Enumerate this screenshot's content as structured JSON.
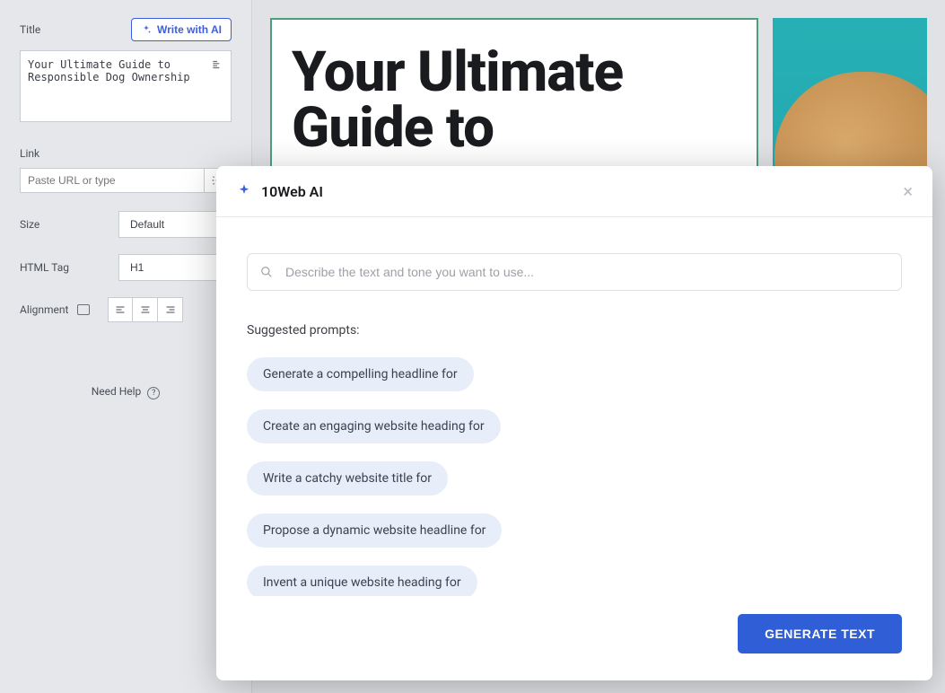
{
  "sidebar": {
    "title_label": "Title",
    "write_ai_label": "Write with AI",
    "title_value": "Your Ultimate Guide to Responsible Dog Ownership",
    "link_label": "Link",
    "link_placeholder": "Paste URL or type",
    "size_label": "Size",
    "size_value": "Default",
    "htmltag_label": "HTML Tag",
    "htmltag_value": "H1",
    "alignment_label": "Alignment",
    "need_help": "Need Help"
  },
  "canvas": {
    "hero_title": "Your Ultimate Guide to"
  },
  "modal": {
    "title": "10Web AI",
    "prompt_placeholder": "Describe the text and tone you want to use...",
    "suggested_label": "Suggested prompts:",
    "suggestions": [
      "Generate a compelling headline for",
      "Create an engaging website heading for",
      "Write a catchy website title for",
      "Propose a dynamic website headline for",
      "Invent a unique website heading for"
    ],
    "generate_label": "GENERATE TEXT"
  }
}
